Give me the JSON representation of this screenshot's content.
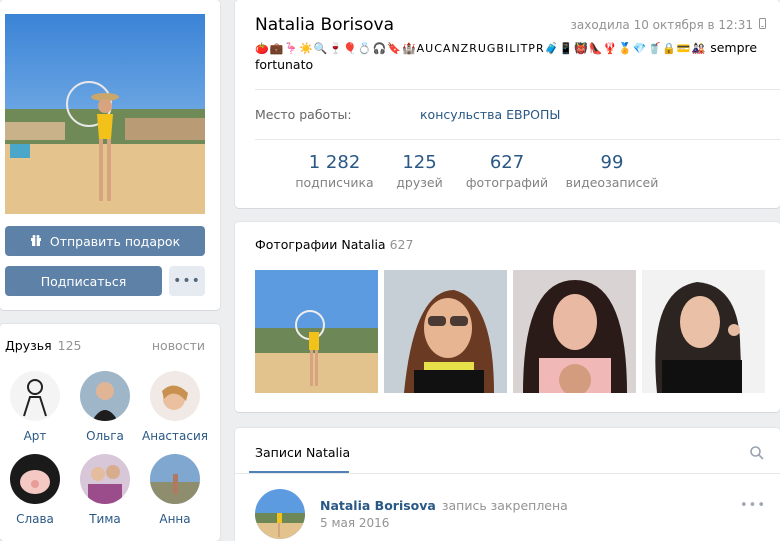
{
  "sidebar": {
    "gift_label": "Отправить подарок",
    "subscribe_label": "Подписаться",
    "more_label": "•••",
    "friends": {
      "title": "Друзья",
      "count": "125",
      "news_label": "новости",
      "items": [
        {
          "name": "Арт"
        },
        {
          "name": "Ольга"
        },
        {
          "name": "Анастасия"
        },
        {
          "name": "Слава"
        },
        {
          "name": "Тима"
        },
        {
          "name": "Анна"
        }
      ]
    }
  },
  "profile": {
    "name": "Natalia Borisova",
    "last_seen": "заходила 10 октября в 12:31",
    "status_emoji": "🍅💼🦩☀️🔍🍷🎈💍🎧🔖🏰AUCANZRUGBILITPR🧳📱👹👠🦞🏅💎🥤🔒💳🎎",
    "status_text": "sempre fortunato",
    "work_label": "Место работы:",
    "work_value": "консульства ЕВРОПЫ",
    "counters": [
      {
        "num": "1 282",
        "label": "подписчика"
      },
      {
        "num": "125",
        "label": "друзей"
      },
      {
        "num": "627",
        "label": "фотографий"
      },
      {
        "num": "99",
        "label": "видеозаписей"
      }
    ]
  },
  "photos": {
    "title": "Фотографии Natalia",
    "count": "627"
  },
  "wall": {
    "tab_label": "Записи Natalia",
    "post": {
      "author": "Natalia Borisova",
      "action": "запись закреплена",
      "date": "5 мая 2016",
      "more_label": "•••"
    }
  },
  "colors": {
    "accent": "#5181b8",
    "link": "#2a5885",
    "button": "#5e81a8",
    "background": "#edeef0"
  }
}
